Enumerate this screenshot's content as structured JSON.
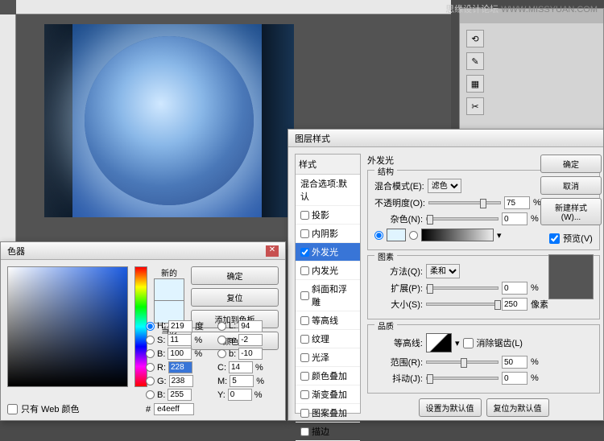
{
  "watermark": {
    "cn": "思缘设计论坛",
    "url": "WWW.MISSYUAN.COM"
  },
  "layerStyle": {
    "title": "图层样式",
    "stylesHeader": "样式",
    "blendDefault": "混合选项:默认",
    "items": {
      "dropShadow": "投影",
      "innerShadow": "内阴影",
      "outerGlow": "外发光",
      "innerGlow": "内发光",
      "bevel": "斜面和浮雕",
      "contour": "等高线",
      "texture": "纹理",
      "satin": "光泽",
      "colorOverlay": "颜色叠加",
      "gradOverlay": "渐变叠加",
      "patternOverlay": "图案叠加",
      "stroke": "描边"
    },
    "outerGlowTitle": "外发光",
    "structure": "结构",
    "blendModeLabel": "混合模式(E):",
    "blendModeValue": "滤色",
    "opacityLabel": "不透明度(O):",
    "opacityValue": "75",
    "noiseLabel": "杂色(N):",
    "noiseValue": "0",
    "pct": "%",
    "elements": "图素",
    "methodLabel": "方法(Q):",
    "methodValue": "柔和",
    "spreadLabel": "扩展(P):",
    "spreadValue": "0",
    "sizeLabel": "大小(S):",
    "sizeValue": "250",
    "px": "像素",
    "quality": "品质",
    "contourLabel": "等高线:",
    "antiAlias": "消除锯齿(L)",
    "rangeLabel": "范围(R):",
    "rangeValue": "50",
    "jitterLabel": "抖动(J):",
    "jitterValue": "0",
    "makeDefault": "设置为默认值",
    "resetDefault": "复位为默认值",
    "ok": "确定",
    "cancel": "取消",
    "newStyle": "新建样式(W)...",
    "preview": "预览(V)"
  },
  "colorPicker": {
    "title": "色器",
    "new": "新的",
    "current": "当前",
    "ok": "确定",
    "reset": "复位",
    "addSwatch": "添加到色板",
    "colorLib": "颜色库",
    "H": "219",
    "Hdeg": "度",
    "S": "11",
    "B": "100",
    "R": "228",
    "G": "238",
    "Bl": "255",
    "L": "94",
    "a": "-2",
    "b": "-10",
    "C": "14",
    "M": "5",
    "Y": "0",
    "pct": "%",
    "webOnly": "只有 Web 颜色",
    "hexLabel": "#",
    "hexValue": "e4eeff"
  }
}
